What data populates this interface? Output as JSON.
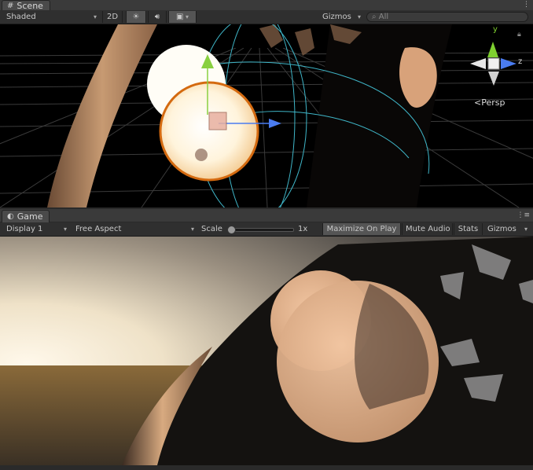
{
  "scene": {
    "tab_label": "Scene",
    "toolbar": {
      "shading_mode": "Shaded",
      "mode_2d": "2D",
      "lighting_icon": "sun-icon",
      "audio_icon": "speaker-icon",
      "effects_icon": "image-icon",
      "gizmos_label": "Gizmos",
      "search_placeholder": "All"
    },
    "persp_label": "Persp",
    "axis_labels": {
      "y": "y",
      "z": "z"
    }
  },
  "game": {
    "tab_label": "Game",
    "toolbar": {
      "display": "Display 1",
      "aspect": "Free Aspect",
      "scale_label": "Scale",
      "scale_value": "1x",
      "scale_level": 0,
      "maximize_on_play": "Maximize On Play",
      "mute_audio": "Mute Audio",
      "stats": "Stats",
      "gizmos": "Gizmos"
    }
  }
}
